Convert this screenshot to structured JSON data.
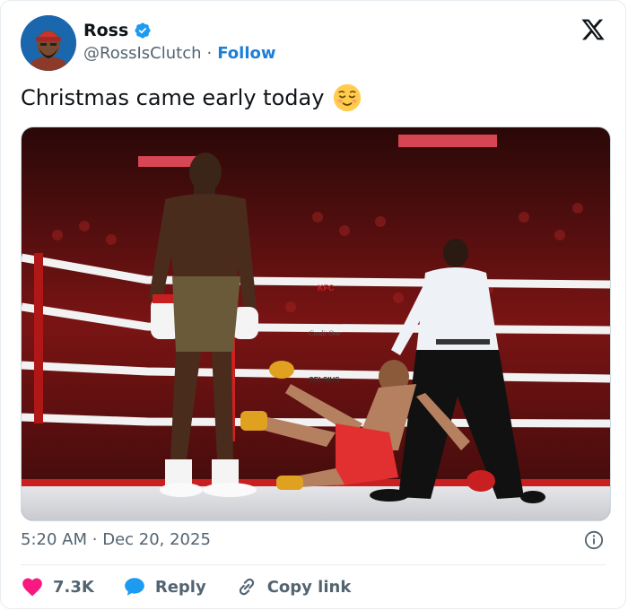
{
  "author": {
    "display_name": "Ross",
    "handle": "@RossIsClutch",
    "separator": "·",
    "follow_label": "Follow",
    "verified": true
  },
  "tweet": {
    "text": "Christmas came early today",
    "emoji": "relieved-face"
  },
  "media": {
    "alt": "",
    "ropes": [
      "KFC",
      "Credit One",
      "CELSIUS"
    ]
  },
  "meta": {
    "time": "5:20 AM",
    "separator": "·",
    "date": "Dec 20, 2025"
  },
  "actions": {
    "likes": "7.3K",
    "reply_label": "Reply",
    "copy_label": "Copy link"
  },
  "colors": {
    "accent": "#1d9bf0",
    "like": "#f91880",
    "muted": "#536471"
  }
}
